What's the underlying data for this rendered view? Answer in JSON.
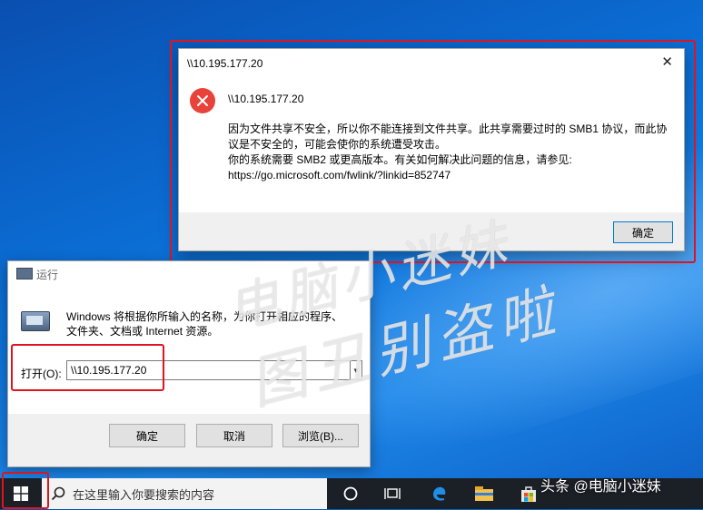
{
  "error_dialog": {
    "title": "\\\\10.195.177.20",
    "close_glyph": "✕",
    "heading": "\\\\10.195.177.20",
    "message_lines": [
      "因为文件共享不安全，所以你不能连接到文件共享。此共享需要过时的 SMB1 协议，而此协",
      "议是不安全的，可能会使你的系统遭受攻击。",
      "你的系统需要 SMB2 或更高版本。有关如何解决此问题的信息，请参见:",
      "https://go.microsoft.com/fwlink/?linkid=852747"
    ],
    "ok_label": "确定",
    "icon": "error-x-icon"
  },
  "run_dialog": {
    "title": "运行",
    "description_lines": [
      "Windows 将根据你所输入的名称，为你打开相应的程序、",
      "文件夹、文档或 Internet 资源。"
    ],
    "open_label": "打开(O):",
    "open_value": "\\\\10.195.177.20",
    "buttons": {
      "ok": "确定",
      "cancel": "取消",
      "browse": "浏览(B)..."
    }
  },
  "watermark": {
    "line1": "电脑小迷妹",
    "line2": "图丑别盗啦"
  },
  "taskbar": {
    "search_placeholder": "在这里输入你要搜索的内容",
    "overlay_text": "头条 @电脑小迷妹",
    "icons": [
      "windows-start-icon",
      "search-icon",
      "cortana-icon",
      "task-view-icon",
      "edge-icon",
      "file-explorer-icon",
      "store-icon"
    ]
  },
  "colors": {
    "highlight": "#e0141e",
    "error_red": "#e8423a",
    "desktop_blue": "#0b6fd6",
    "accent": "#0078d7"
  }
}
